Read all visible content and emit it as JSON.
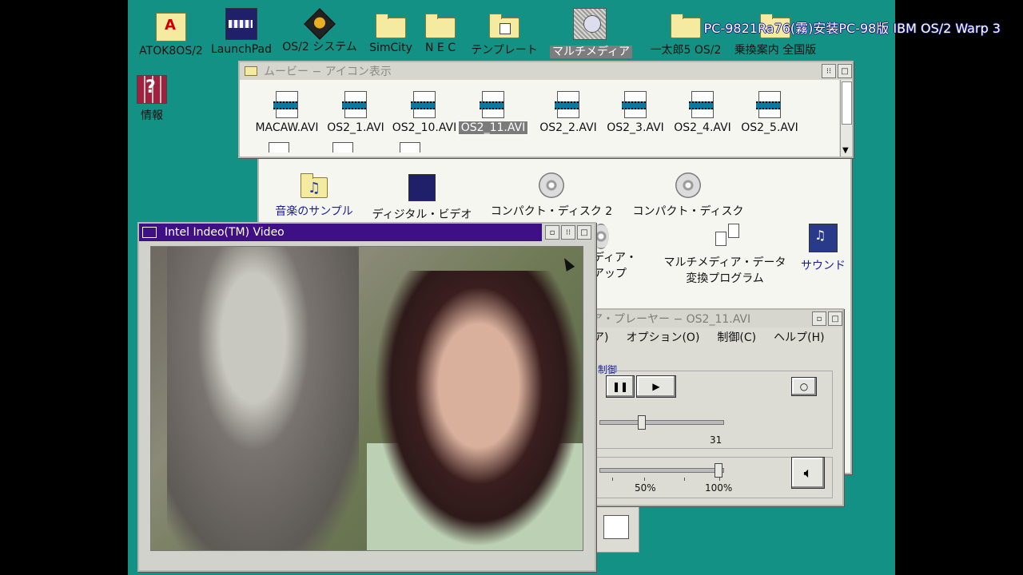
{
  "overlay_title": "PC-9821Ra76(霧)安装PC-98版 IBM OS/2 Warp 3",
  "desktop_icons": [
    {
      "label": "ATOK8OS/2",
      "icon": "atok-icon"
    },
    {
      "label": "LaunchPad",
      "icon": "launchpad-icon"
    },
    {
      "label": "OS/2 システム",
      "icon": "os2-system-icon"
    },
    {
      "label": "SimCity",
      "icon": "folder-icon"
    },
    {
      "label": "N E C",
      "icon": "folder-icon"
    },
    {
      "label": "テンプレート",
      "icon": "template-folder-icon"
    },
    {
      "label": "マルチメディア",
      "icon": "multimedia-icon"
    },
    {
      "label": "一太郎5 OS/2",
      "icon": "folder-icon"
    },
    {
      "label": "乗換案内 全国版",
      "icon": "folder-icon"
    },
    {
      "label": "情報",
      "icon": "info-books-icon"
    }
  ],
  "movie_window": {
    "title": "ムービー − アイコン表示",
    "files": [
      "MACAW.AVI",
      "OS2_1.AVI",
      "OS2_10.AVI",
      "OS2_11.AVI",
      "OS2_2.AVI",
      "OS2_3.AVI",
      "OS2_4.AVI",
      "OS2_5.AVI"
    ],
    "selected_index": 3
  },
  "multimedia_window": {
    "items": [
      {
        "label": "音楽のサンプル",
        "icon": "music-folder-icon"
      },
      {
        "label": "ディジタル・ビデオ",
        "icon": "digital-video-icon"
      },
      {
        "label": "コンパクト・ディスク 2",
        "icon": "cd-icon"
      },
      {
        "label": "コンパクト・ディスク",
        "icon": "cd-icon"
      },
      {
        "label": "ディア・",
        "label2": "アップ",
        "icon": "media-setup-icon"
      },
      {
        "label": "マルチメディア・データ",
        "label2": "変換プログラム",
        "icon": "data-converter-icon"
      },
      {
        "label": "サウンド",
        "icon": "sound-icon"
      }
    ]
  },
  "player_window": {
    "title": "ア・プレーヤー − OS2_11.AVI",
    "menu": [
      "ア)",
      "オプション(O)",
      "制御(C)",
      "ヘルプ(H)"
    ],
    "group_label": "制御",
    "position_label": "31",
    "position_value": 31,
    "volume_labels": [
      "50%",
      "100%"
    ],
    "volume_percent": 100
  },
  "video_window": {
    "title": "Intel Indeo(TM) Video"
  }
}
